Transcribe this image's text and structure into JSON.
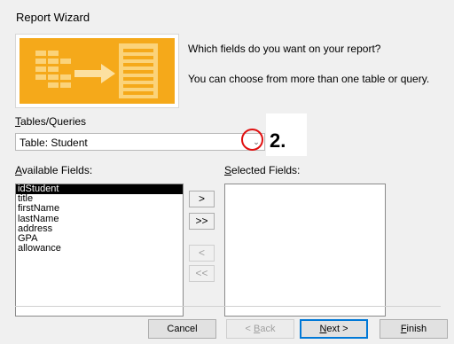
{
  "window": {
    "title": "Report Wizard"
  },
  "intro": {
    "question": "Which fields do you want on your report?",
    "hint": "You can choose from more than one table or query."
  },
  "tables_queries": {
    "label_accel": "T",
    "label_rest": "ables/Queries",
    "selected": "Table: Student"
  },
  "callout": {
    "text": "2.",
    "color": "#e01010"
  },
  "available": {
    "label_accel": "A",
    "label_rest": "vailable Fields:",
    "items": [
      "idStudent",
      "title",
      "firstName",
      "lastName",
      "address",
      "GPA",
      "allowance"
    ]
  },
  "selected_fields": {
    "label_accel": "S",
    "label_rest": "elected Fields:"
  },
  "move_buttons": {
    "add_one": ">",
    "add_all": ">>",
    "remove_one": "<",
    "remove_all": "<<"
  },
  "footer": {
    "cancel": "Cancel",
    "back_prefix": "< ",
    "back_accel": "B",
    "back_rest": "ack",
    "next_accel": "N",
    "next_rest": "ext >",
    "finish_accel": "F",
    "finish_rest": "inish"
  },
  "colors": {
    "banner_orange": "#f5a91a",
    "accent": "#0078d7"
  },
  "icons": {
    "banner": "report-wizard-banner-icon",
    "combo_arrow": "chevron-down-icon"
  }
}
